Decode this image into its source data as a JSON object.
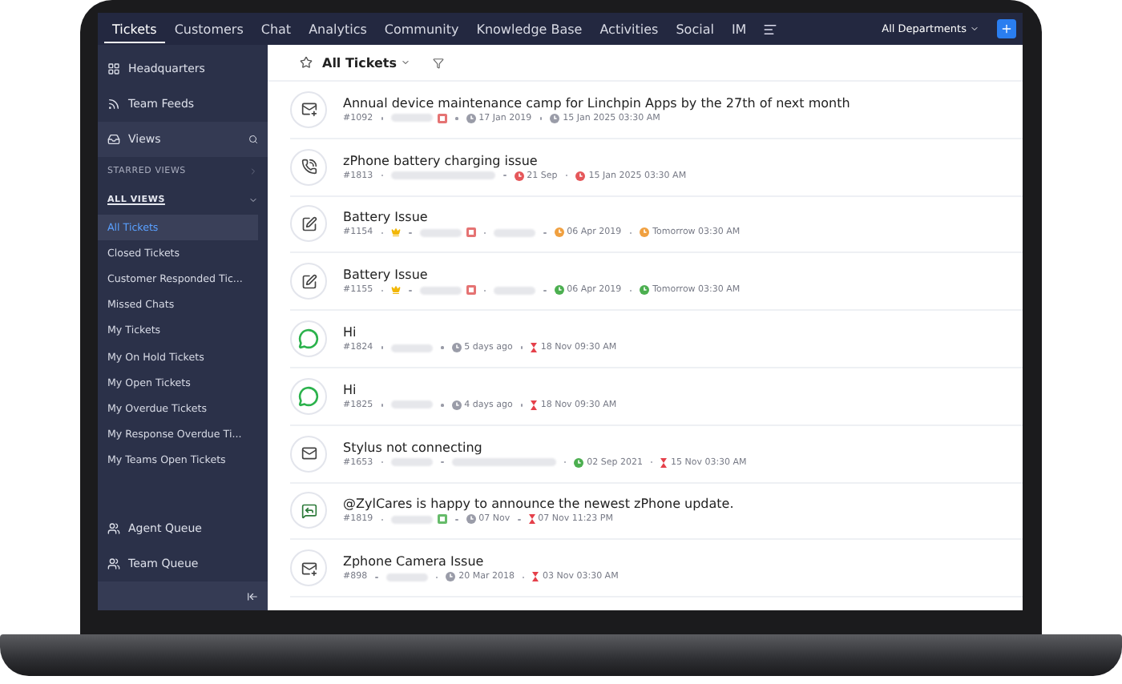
{
  "top_nav": {
    "tabs": [
      {
        "label": "Tickets",
        "selected": true
      },
      {
        "label": "Customers",
        "selected": false
      },
      {
        "label": "Chat",
        "selected": false
      },
      {
        "label": "Analytics",
        "selected": false
      },
      {
        "label": "Community",
        "selected": false
      },
      {
        "label": "Knowledge Base",
        "selected": false
      },
      {
        "label": "Activities",
        "selected": false
      },
      {
        "label": "Social",
        "selected": false
      },
      {
        "label": "IM",
        "selected": false
      }
    ],
    "department": "All Departments"
  },
  "sidebar": {
    "top_items": [
      {
        "label": "Headquarters",
        "kind": "grid"
      },
      {
        "label": "Team Feeds",
        "kind": "feed"
      }
    ],
    "views": {
      "label": "Views"
    },
    "starred_views": {
      "label": "STARRED VIEWS",
      "expanded": false
    },
    "all_views": {
      "label": "ALL VIEWS",
      "expanded": true
    },
    "view_items": [
      {
        "label": "All Tickets",
        "selected": true
      },
      {
        "label": "Closed Tickets",
        "selected": false
      },
      {
        "label": "Customer Responded Tic...",
        "selected": false
      },
      {
        "label": "Missed Chats",
        "selected": false
      },
      {
        "label": "My Tickets",
        "selected": false
      },
      {
        "label": "My On Hold Tickets",
        "selected": false
      },
      {
        "label": "My Open Tickets",
        "selected": false
      },
      {
        "label": "My Overdue Tickets",
        "selected": false
      },
      {
        "label": "My Response Overdue Ti...",
        "selected": false
      },
      {
        "label": "My Teams Open Tickets",
        "selected": false
      }
    ],
    "bottom_items": [
      {
        "label": "Agent Queue"
      },
      {
        "label": "Team Queue"
      }
    ]
  },
  "view_header": {
    "title": "All Tickets"
  },
  "tickets": [
    {
      "kind": "mail-in",
      "title": "Annual device maintenance camp for Linchpin Apps by the 27th of next month",
      "meta": [
        {
          "kind": "id",
          "text": "#1092"
        },
        {
          "kind": "blur"
        },
        {
          "kind": "tag",
          "color": "#e57373"
        },
        {
          "kind": "response",
          "text": "17 Jan 2019",
          "color": "#9a9ca8"
        },
        {
          "kind": "due-clock",
          "text": "15 Jan 2025 03:30 AM",
          "color": "#9a9ca8"
        }
      ]
    },
    {
      "kind": "phone",
      "title": "zPhone battery charging issue",
      "meta": [
        {
          "kind": "id",
          "text": "#1813"
        },
        {
          "kind": "blur-long"
        },
        {
          "kind": "response",
          "text": "21 Sep",
          "color": "#e5575a"
        },
        {
          "kind": "due-clock",
          "text": "15 Jan 2025 03:30 AM",
          "color": "#e5575a"
        }
      ]
    },
    {
      "kind": "form",
      "title": "Battery Issue",
      "meta": [
        {
          "kind": "id",
          "text": "#1154"
        },
        {
          "kind": "crown"
        },
        {
          "kind": "blur"
        },
        {
          "kind": "tag",
          "color": "#e57373"
        },
        {
          "kind": "blur"
        },
        {
          "kind": "response",
          "text": "06 Apr 2019",
          "color": "#f0a040"
        },
        {
          "kind": "due-clock",
          "text": "Tomorrow 03:30 AM",
          "color": "#f0a040"
        }
      ]
    },
    {
      "kind": "form",
      "title": "Battery Issue",
      "meta": [
        {
          "kind": "id",
          "text": "#1155"
        },
        {
          "kind": "crown"
        },
        {
          "kind": "blur"
        },
        {
          "kind": "tag",
          "color": "#e57373"
        },
        {
          "kind": "blur"
        },
        {
          "kind": "response",
          "text": "06 Apr 2019",
          "color": "#4caf50"
        },
        {
          "kind": "due-clock",
          "text": "Tomorrow 03:30 AM",
          "color": "#4caf50"
        }
      ]
    },
    {
      "kind": "whatsapp",
      "title": "Hi",
      "meta": [
        {
          "kind": "id",
          "text": "#1824"
        },
        {
          "kind": "blur"
        },
        {
          "kind": "response",
          "text": "5 days ago",
          "color": "#9a9ca8"
        },
        {
          "kind": "due-timer",
          "text": "18 Nov 09:30 AM",
          "color": "#e5404a"
        }
      ]
    },
    {
      "kind": "whatsapp",
      "title": "Hi",
      "meta": [
        {
          "kind": "id",
          "text": "#1825"
        },
        {
          "kind": "blur"
        },
        {
          "kind": "response",
          "text": "4 days ago",
          "color": "#9a9ca8"
        },
        {
          "kind": "due-timer",
          "text": "18 Nov 09:30 AM",
          "color": "#e5404a"
        }
      ]
    },
    {
      "kind": "mail",
      "title": "Stylus not connecting",
      "meta": [
        {
          "kind": "id",
          "text": "#1653"
        },
        {
          "kind": "blur"
        },
        {
          "kind": "blur-long"
        },
        {
          "kind": "response",
          "text": "02 Sep 2021",
          "color": "#4caf50"
        },
        {
          "kind": "due-timer",
          "text": "15 Nov 03:30 AM",
          "color": "#e5404a"
        }
      ]
    },
    {
      "kind": "social",
      "title": "@ZylCares is happy to announce the newest zPhone update.",
      "meta": [
        {
          "kind": "id",
          "text": "#1819"
        },
        {
          "kind": "blur"
        },
        {
          "kind": "tag",
          "color": "#66bb6a"
        },
        {
          "kind": "response",
          "text": "07 Nov",
          "color": "#9a9ca8"
        },
        {
          "kind": "due-timer",
          "text": "07 Nov 11:23 PM",
          "color": "#e5404a"
        }
      ]
    },
    {
      "kind": "mail-in",
      "title": "Zphone Camera Issue",
      "meta": [
        {
          "kind": "id",
          "text": "#898"
        },
        {
          "kind": "blur"
        },
        {
          "kind": "response",
          "text": "20 Mar 2018",
          "color": "#9a9ca8"
        },
        {
          "kind": "due-timer",
          "text": "03 Nov 03:30 AM",
          "color": "#e5404a"
        }
      ]
    }
  ]
}
